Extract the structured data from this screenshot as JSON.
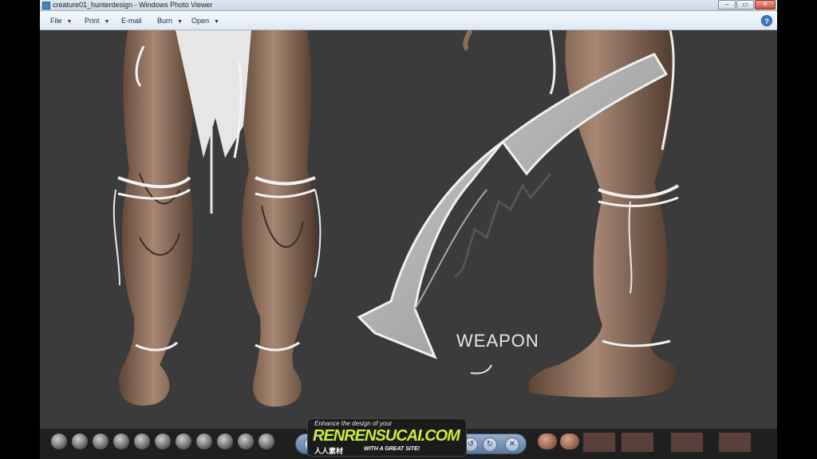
{
  "window": {
    "title": "creature01_hunterdesign - Windows Photo Viewer",
    "controls": {
      "minimize": "–",
      "maximize": "▭",
      "close": "✕"
    }
  },
  "menu": {
    "items": [
      "File",
      "Print",
      "E-mail",
      "Burn",
      "Open"
    ],
    "help": "?"
  },
  "canvas": {
    "annotation": "WEAPON"
  },
  "nav": {
    "zoom": "⚲",
    "fit": "⊡",
    "prev": "⏮",
    "next": "⏭",
    "rotate_ccw": "↺",
    "rotate_cw": "↻",
    "delete": "✕"
  },
  "watermark": {
    "tagline": "Enhance the design of your",
    "brand": "RENRENSUCAI.COM",
    "cn": "人人素材",
    "sub": "WITH A GREAT SITE!"
  },
  "colors": {
    "canvas_bg": "#3b3b3b",
    "skin": "#8c6d58",
    "accent": "#3b78c8",
    "logo": "#c8ef3a"
  }
}
